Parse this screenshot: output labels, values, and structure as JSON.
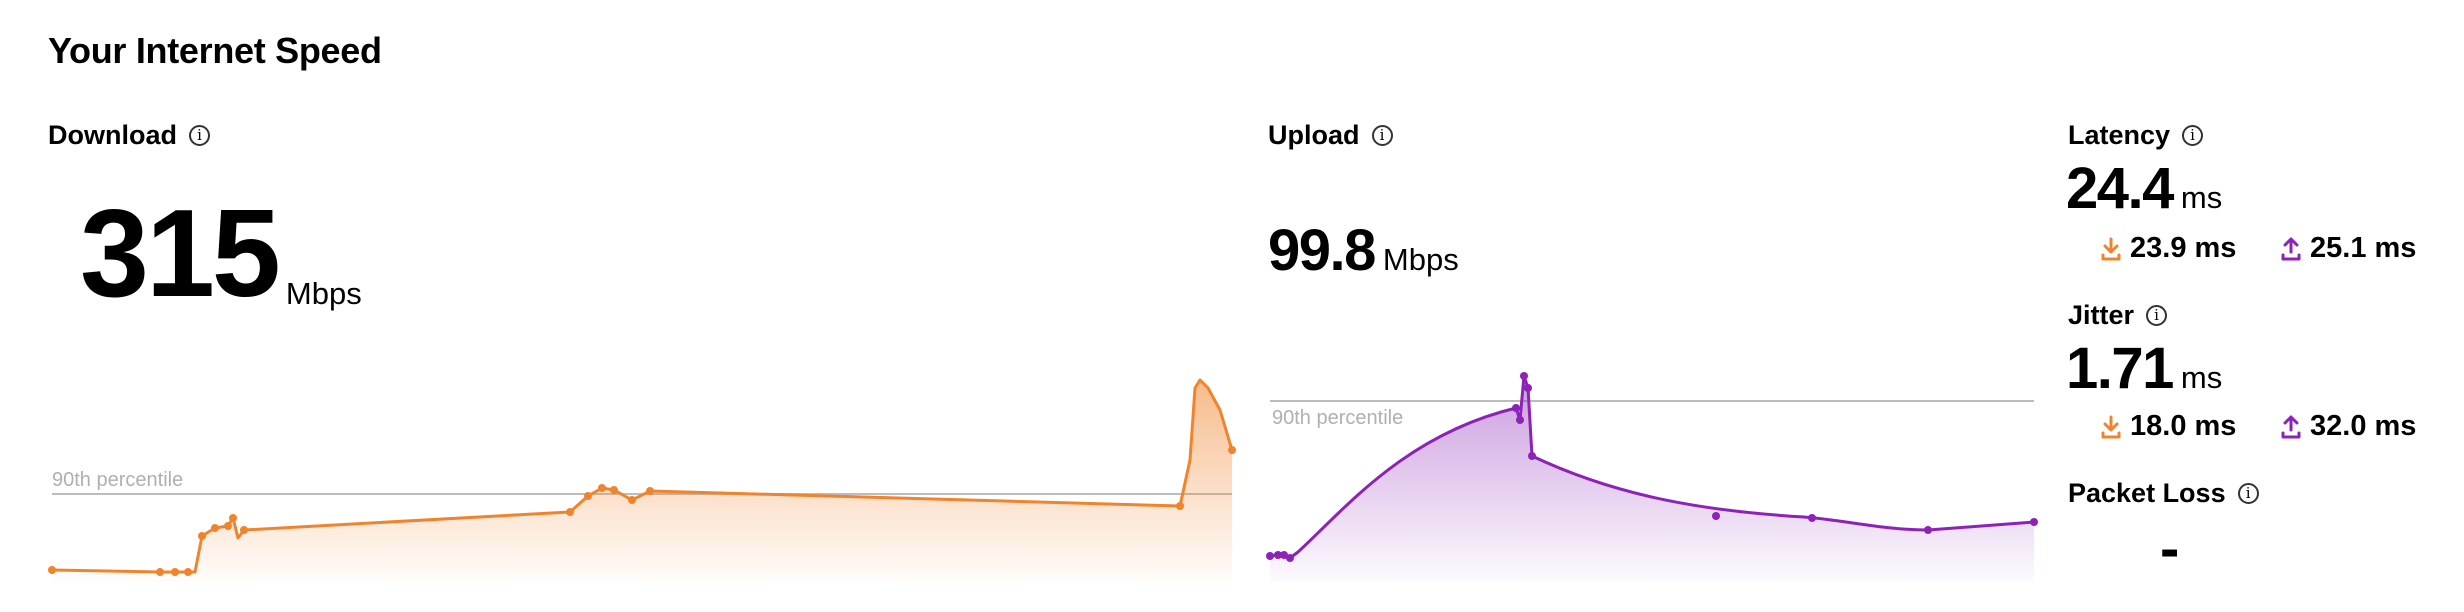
{
  "page": {
    "title": "Your Internet Speed"
  },
  "download": {
    "label": "Download",
    "value": "315",
    "unit": "Mbps",
    "percentile_label": "90th percentile",
    "color": "#f0842c"
  },
  "upload": {
    "label": "Upload",
    "value": "99.8",
    "unit": "Mbps",
    "percentile_label": "90th percentile",
    "color": "#8c22b8"
  },
  "latency": {
    "label": "Latency",
    "value": "24.4",
    "unit": "ms",
    "down": "23.9 ms",
    "up": "25.1 ms"
  },
  "jitter": {
    "label": "Jitter",
    "value": "1.71",
    "unit": "ms",
    "down": "18.0 ms",
    "up": "32.0 ms"
  },
  "packet_loss": {
    "label": "Packet Loss",
    "value": "-"
  },
  "icons": {
    "info": "info-icon",
    "download_arrow": "download-arrow-icon",
    "upload_arrow": "upload-arrow-icon"
  }
}
